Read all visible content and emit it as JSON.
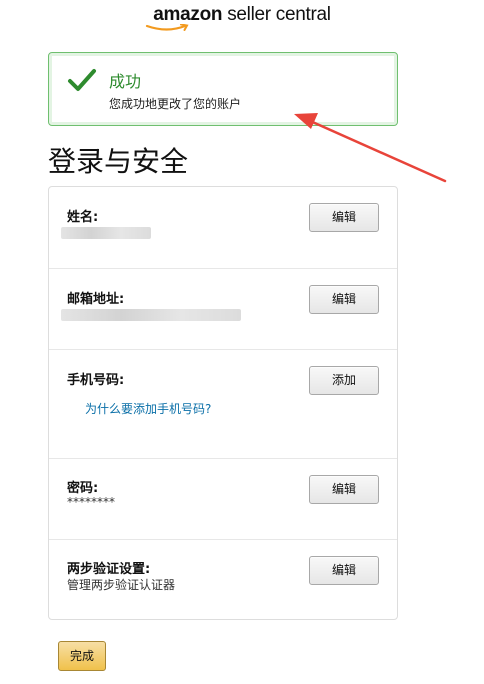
{
  "logo": {
    "text_amazon": "amazon",
    "text_rest": " seller central"
  },
  "alert": {
    "title": "成功",
    "message": "您成功地更改了您的账户"
  },
  "page": {
    "title": "登录与安全"
  },
  "rows": {
    "name": {
      "label": "姓名:",
      "button": "编辑"
    },
    "email": {
      "label": "邮箱地址:",
      "button": "编辑"
    },
    "phone": {
      "label": "手机号码:",
      "link": "为什么要添加手机号码?",
      "button": "添加"
    },
    "password": {
      "label": "密码:",
      "value": "********",
      "button": "编辑"
    },
    "two_step": {
      "label": "两步验证设置:",
      "value": "管理两步验证认证器",
      "button": "编辑"
    }
  },
  "done_button": "完成",
  "colors": {
    "success_green": "#2e8b2e",
    "link_blue": "#0a6fa8",
    "annotation_red": "#e8443a",
    "primary_button": "#f0c14b"
  }
}
